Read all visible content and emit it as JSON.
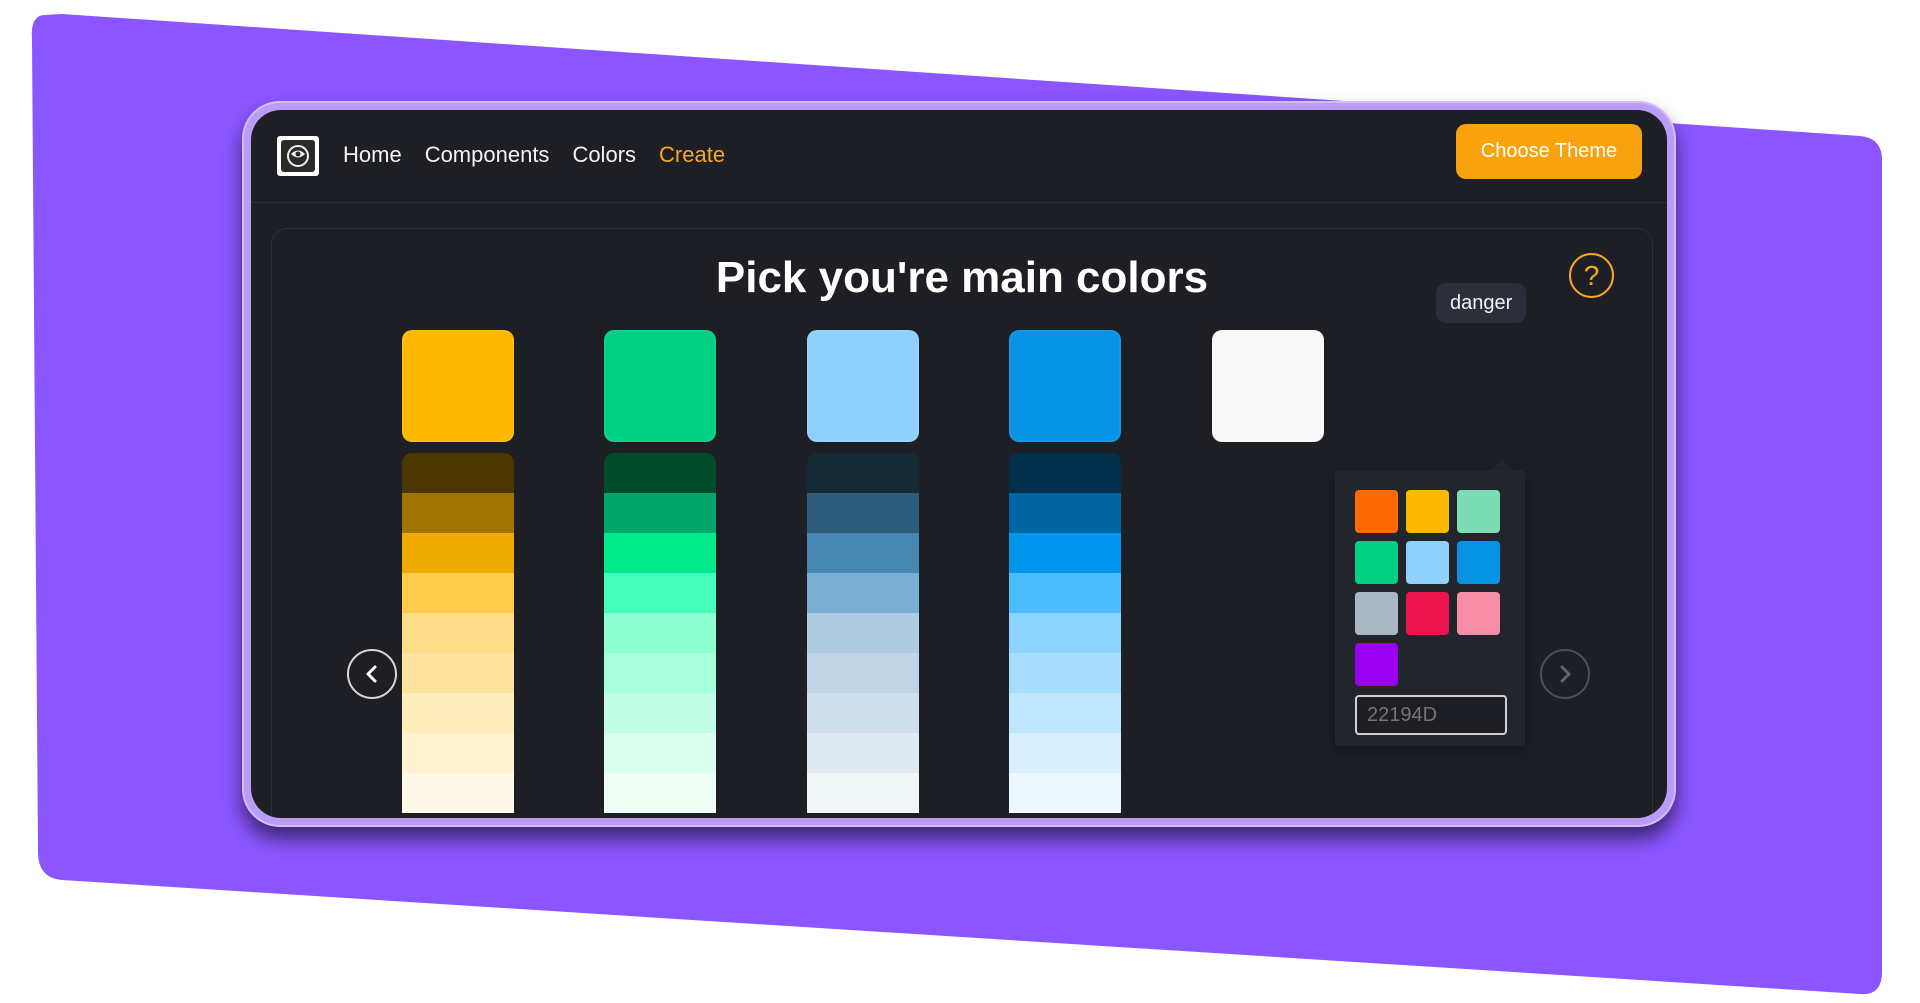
{
  "nav": {
    "logo_icon": "app-logo-icon",
    "links": [
      "Home",
      "Components",
      "Colors",
      "Create"
    ],
    "active_link": "Create",
    "choose_theme_label": "Choose Theme"
  },
  "main": {
    "title": "Pick you're main colors",
    "help_label": "?",
    "help_icon": "question-circle-icon",
    "prev_icon": "chevron-left-icon",
    "next_icon": "chevron-right-icon",
    "tooltip": "danger",
    "columns": [
      {
        "main_color": "#FDB902",
        "shades": [
          "#4D3700",
          "#A17400",
          "#EEAB00",
          "#FFCC4A",
          "#FFDD88",
          "#FFE49F",
          "#FFEDBC",
          "#FFF3D2",
          "#FFF8E8"
        ]
      },
      {
        "main_color": "#00D084",
        "shades": [
          "#004B2C",
          "#00A66A",
          "#00EB8C",
          "#44FFBB",
          "#8DFFD1",
          "#A7FFDB",
          "#C0FFE5",
          "#D9FFEE",
          "#EEFFF8"
        ]
      },
      {
        "main_color": "#8ED1FC",
        "shades": [
          "#152A37",
          "#2E5C7A",
          "#4788B3",
          "#7AAFD2",
          "#AECBE0",
          "#BFD5E6",
          "#CFE0EC",
          "#E0EAF2",
          "#F0F5F8"
        ]
      },
      {
        "main_color": "#0693E3",
        "shades": [
          "#012F4C",
          "#0066A3",
          "#0096EE",
          "#4CBCFF",
          "#8CD3FF",
          "#A7DDFF",
          "#BFE6FF",
          "#D7EFFF",
          "#ECF7FF"
        ]
      },
      {
        "main_color": "#F9F9F9",
        "shades": []
      }
    ],
    "picker": {
      "chips": [
        "#FF6900",
        "#FCB900",
        "#7BDCB5",
        "#00D084",
        "#8ED1FC",
        "#0693E3",
        "#ABB8C3",
        "#EB144C",
        "#F78DA7",
        "#9900EF"
      ],
      "hex_placeholder": "22194D"
    }
  }
}
